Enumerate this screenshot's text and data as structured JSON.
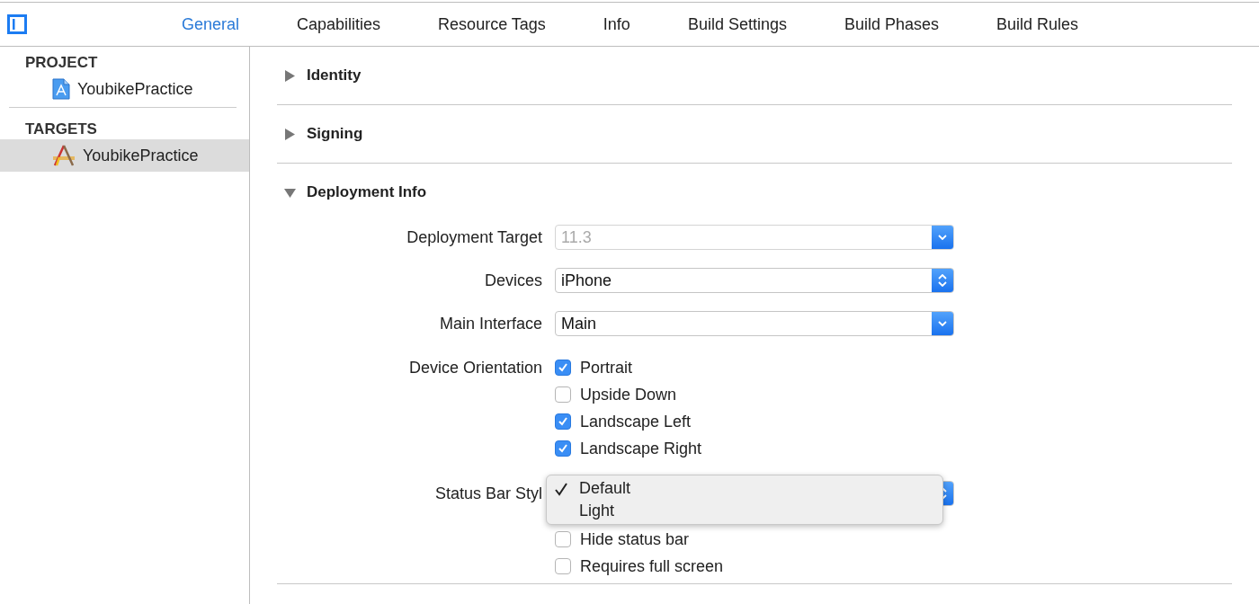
{
  "tabs": [
    {
      "label": "General",
      "selected": true
    },
    {
      "label": "Capabilities",
      "selected": false
    },
    {
      "label": "Resource Tags",
      "selected": false
    },
    {
      "label": "Info",
      "selected": false
    },
    {
      "label": "Build Settings",
      "selected": false
    },
    {
      "label": "Build Phases",
      "selected": false
    },
    {
      "label": "Build Rules",
      "selected": false
    }
  ],
  "sidebar": {
    "groups": [
      {
        "heading": "PROJECT",
        "items": [
          {
            "label": "YoubikePractice",
            "kind": "project",
            "selected": false
          }
        ]
      },
      {
        "heading": "TARGETS",
        "items": [
          {
            "label": "YoubikePractice",
            "kind": "target",
            "selected": true
          }
        ]
      }
    ]
  },
  "sections": [
    {
      "title": "Identity",
      "expanded": false
    },
    {
      "title": "Signing",
      "expanded": false
    },
    {
      "title": "Deployment Info",
      "expanded": true,
      "fields": [
        {
          "kind": "popup",
          "label": "Deployment Target",
          "value": "11.3",
          "disabled": true
        },
        {
          "kind": "stepper",
          "label": "Devices",
          "value": "iPhone",
          "disabled": false
        },
        {
          "kind": "popup",
          "label": "Main Interface",
          "value": "Main",
          "disabled": false
        },
        {
          "kind": "checks",
          "label": "Device Orientation",
          "options": [
            {
              "label": "Portrait",
              "checked": true
            },
            {
              "label": "Upside Down",
              "checked": false
            },
            {
              "label": "Landscape Left",
              "checked": true
            },
            {
              "label": "Landscape Right",
              "checked": true
            }
          ]
        },
        {
          "kind": "stepper",
          "label": "Status Bar Styl",
          "menu": {
            "items": [
              {
                "label": "Default",
                "selected": true
              },
              {
                "label": "Light",
                "selected": false
              }
            ]
          }
        },
        {
          "kind": "checks",
          "options": [
            {
              "label": "Hide status bar",
              "checked": false
            },
            {
              "label": "Requires full screen",
              "checked": false
            }
          ]
        }
      ]
    }
  ]
}
